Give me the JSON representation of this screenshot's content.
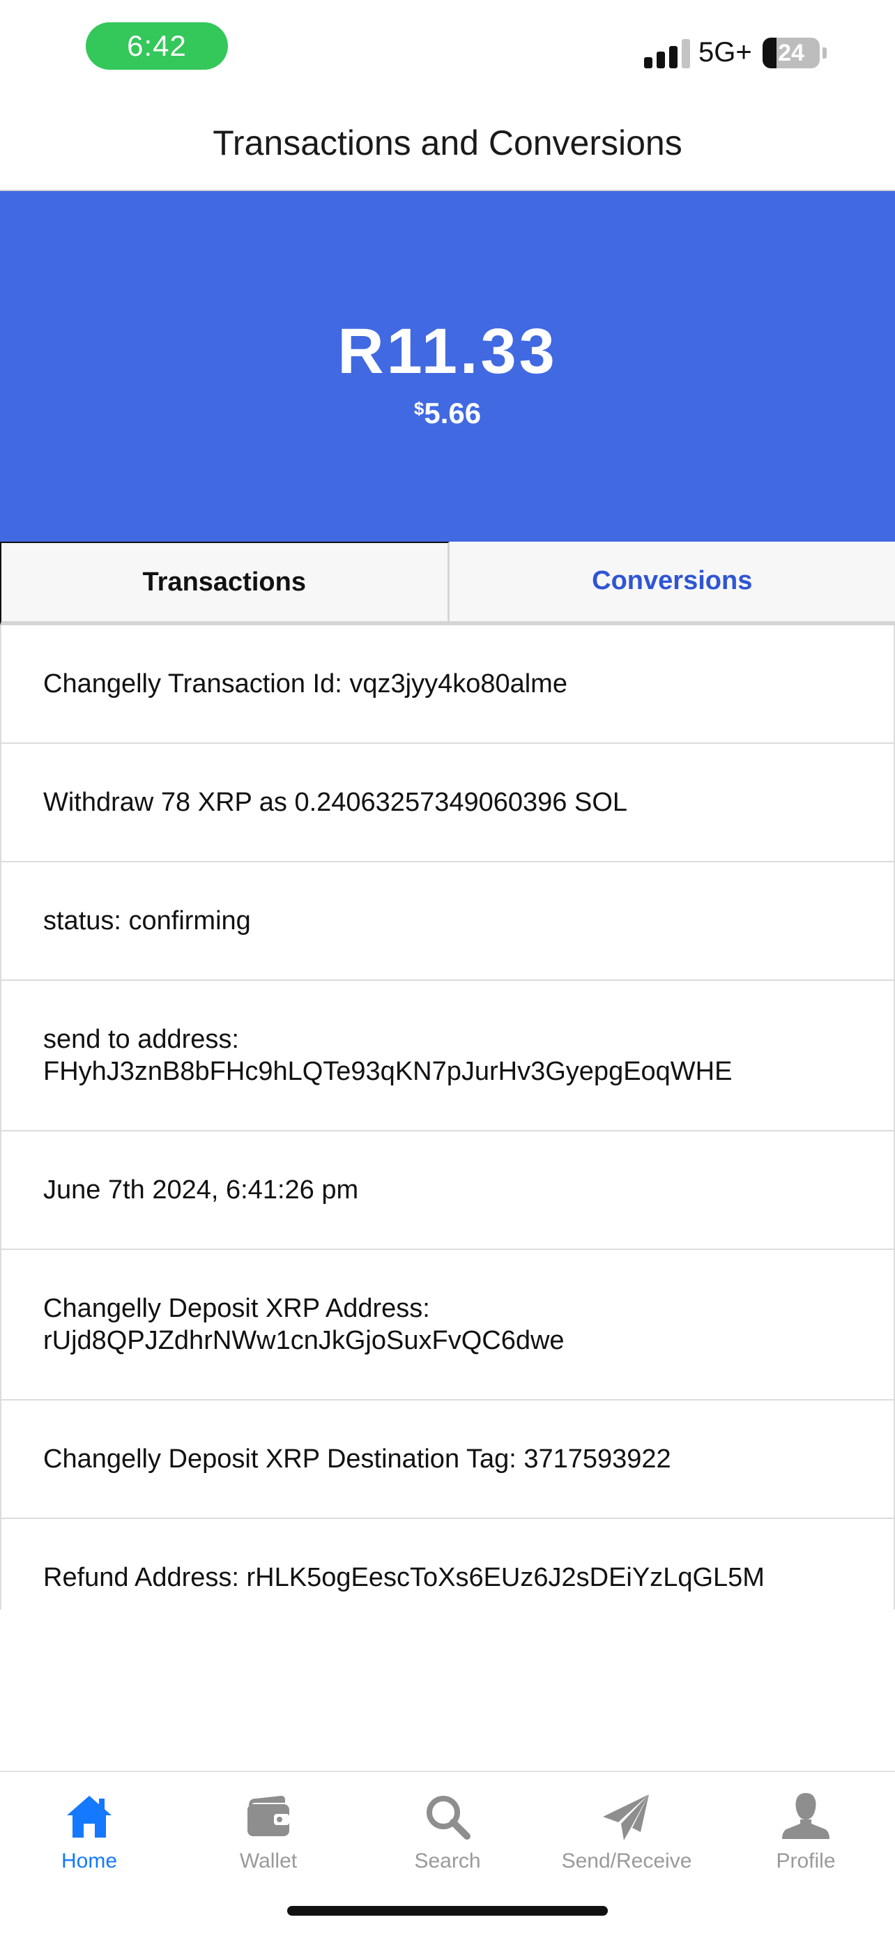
{
  "status_bar": {
    "time": "6:42",
    "network": "5G+",
    "battery_percent": "24",
    "battery_level": 0.24,
    "signal_bars_filled": 3,
    "signal_bars_total": 4,
    "time_pill_color": "#34c759"
  },
  "header": {
    "title": "Transactions and Conversions"
  },
  "balance": {
    "primary": "R11.33",
    "secondary_currency": "$",
    "secondary_amount": "5.66",
    "banner_color": "#4169e1"
  },
  "tabs": {
    "transactions_label": "Transactions",
    "conversions_label": "Conversions",
    "active": "conversions",
    "active_color": "#2f55d4"
  },
  "details": {
    "rows": [
      "Changelly Transaction Id: vqz3jyy4ko80alme",
      "Withdraw 78 XRP as 0.24063257349060396 SOL",
      "status: confirming",
      "send to address:\nFHyhJ3znB8bFHc9hLQTe93qKN7pJurHv3GyepgEoqWHE",
      "June 7th 2024, 6:41:26 pm",
      "Changelly Deposit XRP Address:\nrUjd8QPJZdhrNWw1cnJkGjoSuxFvQC6dwe",
      "Changelly Deposit XRP Destination Tag: 3717593922",
      "Refund Address: rHLK5ogEescToXs6EUz6J2sDEiYzLqGL5M"
    ]
  },
  "bottom_nav": {
    "items": [
      {
        "label": "Home",
        "icon": "home-icon",
        "active": true
      },
      {
        "label": "Wallet",
        "icon": "wallet-icon",
        "active": false
      },
      {
        "label": "Search",
        "icon": "search-icon",
        "active": false
      },
      {
        "label": "Send/Receive",
        "icon": "paper-plane-icon",
        "active": false
      },
      {
        "label": "Profile",
        "icon": "person-icon",
        "active": false
      }
    ],
    "active_color": "#1479ff",
    "inactive_color": "#9a9a9a"
  }
}
